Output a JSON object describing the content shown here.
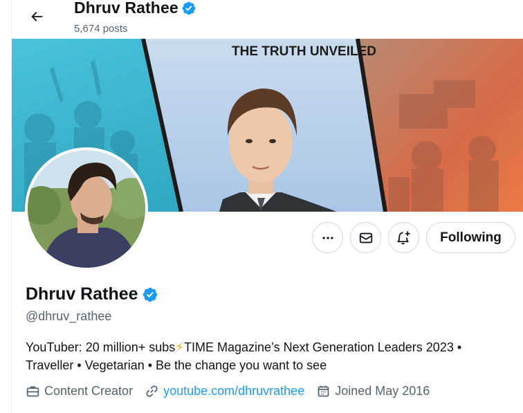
{
  "header": {
    "name": "Dhruv Rathee",
    "posts_count": "5,674 posts"
  },
  "banner": {
    "caption": "THE TRUTH UNVEILED"
  },
  "actions": {
    "follow_label": "Following"
  },
  "profile": {
    "display_name": "Dhruv Rathee",
    "handle": "@dhruv_rathee",
    "bio_line1_a": "YouTuber: 20 million+ subs",
    "bio_emoji": "⚡",
    "bio_line1_b": "TIME Magazine’s Next Generation Leaders 2023 •",
    "bio_line2": "Traveller • Vegetarian • Be the change you want to see",
    "category": "Content Creator",
    "website": "youtube.com/dhruvrathee",
    "joined": "Joined May 2016"
  },
  "icons": {
    "back": "arrow-left-icon",
    "verified": "verified-badge-icon",
    "more": "more-icon",
    "message": "envelope-icon",
    "notify": "bell-plus-icon",
    "category": "briefcase-icon",
    "link": "link-icon",
    "calendar": "calendar-icon"
  },
  "colors": {
    "accent": "#1d9bf0",
    "text": "#0f1419",
    "secondary": "#536471",
    "border": "#cfd9de"
  }
}
